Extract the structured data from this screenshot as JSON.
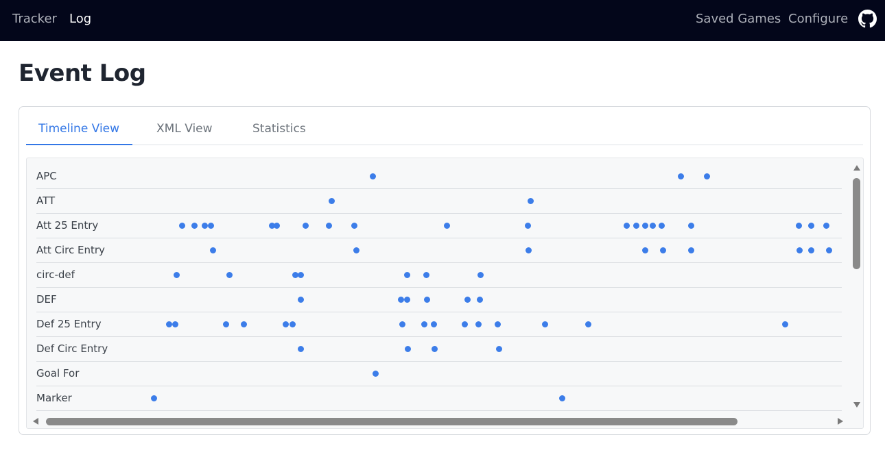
{
  "nav": {
    "left": [
      {
        "label": "Tracker",
        "active": false
      },
      {
        "label": "Log",
        "active": true
      }
    ],
    "right": [
      {
        "label": "Saved Games"
      },
      {
        "label": "Configure"
      }
    ],
    "github_icon": "github-icon"
  },
  "page": {
    "title": "Event Log"
  },
  "tabs": [
    {
      "label": "Timeline View",
      "active": true
    },
    {
      "label": "XML View",
      "active": false
    },
    {
      "label": "Statistics",
      "active": false
    }
  ],
  "colors": {
    "accent": "#3377e6",
    "dot": "#3c7de9",
    "navbar": "#03061a"
  },
  "timeline": {
    "rows": [
      {
        "label": "APC",
        "events": [
          543,
          992,
          1030
        ]
      },
      {
        "label": "ATT",
        "events": [
          483,
          773
        ]
      },
      {
        "label": "Att 25 Entry",
        "events": [
          265,
          283,
          298,
          307,
          396,
          403,
          445,
          479,
          516,
          651,
          769,
          913,
          927,
          940,
          951,
          964,
          1007,
          1164,
          1182,
          1204
        ]
      },
      {
        "label": "Att Circ Entry",
        "events": [
          310,
          519,
          770,
          940,
          966,
          1007,
          1165,
          1182,
          1208
        ]
      },
      {
        "label": "circ-def",
        "events": [
          257,
          334,
          430,
          438,
          593,
          621,
          700
        ]
      },
      {
        "label": "DEF",
        "events": [
          438,
          584,
          593,
          622,
          681,
          699
        ]
      },
      {
        "label": "Def 25 Entry",
        "events": [
          246,
          255,
          329,
          355,
          416,
          426,
          586,
          618,
          632,
          677,
          697,
          725,
          794,
          857,
          1144
        ]
      },
      {
        "label": "Def Circ Entry",
        "events": [
          438,
          594,
          633,
          727
        ]
      },
      {
        "label": "Goal For",
        "events": [
          547
        ]
      },
      {
        "label": "Marker",
        "events": [
          224,
          819
        ]
      }
    ]
  }
}
